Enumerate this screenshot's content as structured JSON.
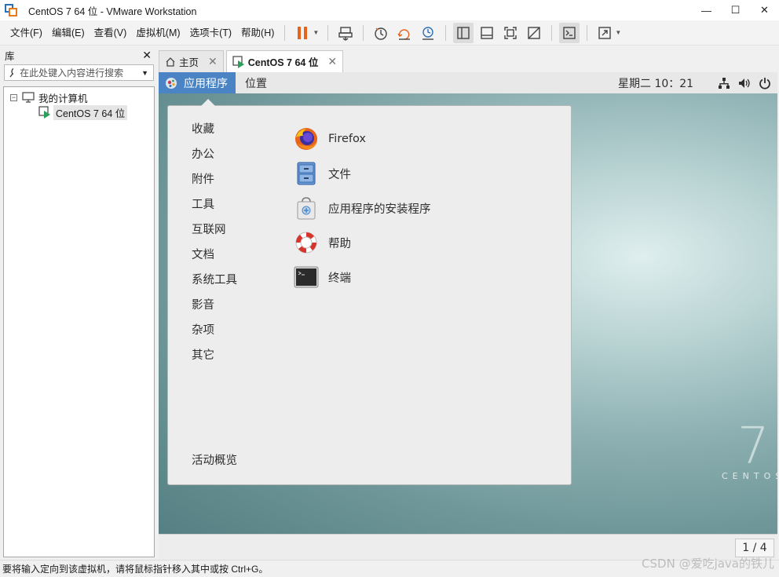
{
  "window": {
    "title": "CentOS 7 64 位 - VMware Workstation",
    "minimize": "—",
    "maximize": "☐",
    "close": "✕"
  },
  "menubar": {
    "items": [
      "文件(F)",
      "编辑(E)",
      "查看(V)",
      "虚拟机(M)",
      "选项卡(T)",
      "帮助(H)"
    ]
  },
  "library": {
    "title": "库",
    "close": "✕",
    "search_placeholder": "在此处键入内容进行搜索",
    "tree_root": "我的计算机",
    "tree_expander": "−",
    "tree_child": "CentOS 7 64 位"
  },
  "tabs": [
    {
      "label": "主页",
      "close": "✕"
    },
    {
      "label": "CentOS 7 64 位",
      "close": "✕"
    }
  ],
  "guest": {
    "apps_button": "应用程序",
    "places_button": "位置",
    "clock": "星期二 10：21",
    "brand_number": "7",
    "brand_word": "CENTOS",
    "categories": [
      "收藏",
      "办公",
      "附件",
      "工具",
      "互联网",
      "文档",
      "系统工具",
      "影音",
      "杂项",
      "其它"
    ],
    "activities": "活动概览",
    "apps": [
      {
        "name": "Firefox",
        "icon": "firefox-icon"
      },
      {
        "name": "文件",
        "icon": "files-cabinet-icon"
      },
      {
        "name": "应用程序的安装程序",
        "icon": "software-installer-icon"
      },
      {
        "name": "帮助",
        "icon": "help-lifebuoy-icon"
      },
      {
        "name": "终端",
        "icon": "terminal-icon"
      }
    ],
    "pager": "1 / 4"
  },
  "statusbar": {
    "text": "要将输入定向到该虚拟机，请将鼠标指针移入其中或按 Ctrl+G。"
  },
  "watermark": "CSDN @爱吃java的铁儿",
  "colors": {
    "accent": "#4a84c4",
    "pause": "#e8641c"
  }
}
